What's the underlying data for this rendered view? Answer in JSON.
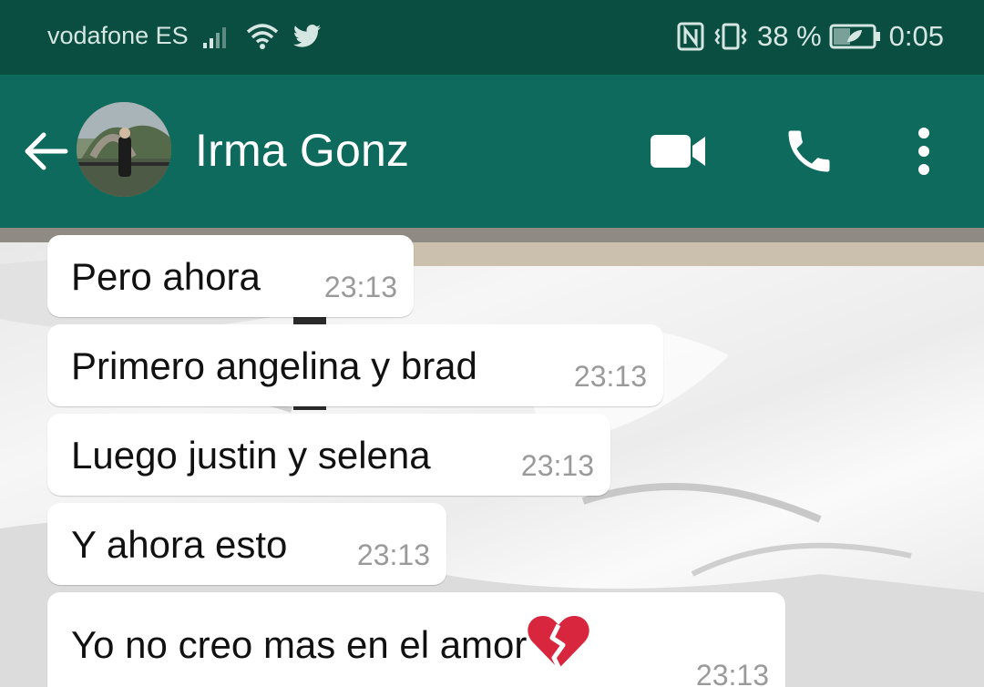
{
  "status_bar": {
    "carrier": "vodafone ES",
    "battery_percent": "38 %",
    "time": "0:05",
    "icons": [
      "signal-icon",
      "wifi-icon",
      "twitter-icon",
      "nfc-icon",
      "vibrate-icon",
      "battery-icon"
    ]
  },
  "header": {
    "contact_name": "Irma Gonz",
    "icons": [
      "back-arrow-icon",
      "video-call-icon",
      "phone-icon",
      "more-icon"
    ]
  },
  "messages": [
    {
      "text": "Pero ahora",
      "time": "23:13"
    },
    {
      "text": "Primero angelina y brad",
      "time": "23:13"
    },
    {
      "text": "Luego justin y selena",
      "time": "23:13"
    },
    {
      "text": "Y ahora esto",
      "time": "23:13"
    },
    {
      "text": "Yo no creo mas en el amor",
      "time": "23:13",
      "emoji": "broken-heart-icon"
    }
  ],
  "colors": {
    "status_bar_bg": "#0a4d41",
    "app_bar_bg": "#0e6a5c",
    "bubble_bg": "#ffffff",
    "time_text": "#9a9a9a"
  }
}
